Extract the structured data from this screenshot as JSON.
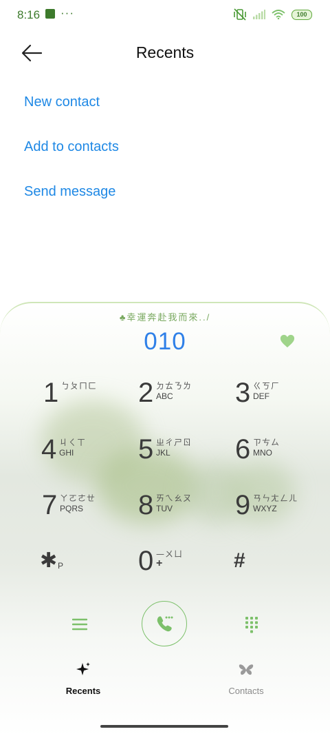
{
  "status_bar": {
    "time": "8:16",
    "dots": "···",
    "battery": "100"
  },
  "header": {
    "title": "Recents"
  },
  "options": {
    "new_contact": "New contact",
    "add_to_contacts": "Add to contacts",
    "send_message": "Send message"
  },
  "dialer": {
    "slogan": "幸運奔赴我而來../",
    "number": "010",
    "keys": [
      {
        "digit": "1",
        "zhuyin": "ㄅㄆㄇㄈ",
        "letters": ""
      },
      {
        "digit": "2",
        "zhuyin": "ㄉㄊㄋㄌ",
        "letters": "ABC"
      },
      {
        "digit": "3",
        "zhuyin": "ㄍㄎㄏ",
        "letters": "DEF"
      },
      {
        "digit": "4",
        "zhuyin": "ㄐㄑㄒ",
        "letters": "GHI"
      },
      {
        "digit": "5",
        "zhuyin": "ㄓㄔㄕㄖ",
        "letters": "JKL"
      },
      {
        "digit": "6",
        "zhuyin": "ㄗㄘㄙ",
        "letters": "MNO"
      },
      {
        "digit": "7",
        "zhuyin": "ㄚㄛㄜㄝ",
        "letters": "PQRS"
      },
      {
        "digit": "8",
        "zhuyin": "ㄞㄟㄠㄡ",
        "letters": "TUV"
      },
      {
        "digit": "9",
        "zhuyin": "ㄢㄣㄤㄥㄦ",
        "letters": "WXYZ"
      },
      {
        "digit": "✱",
        "zhuyin": "",
        "letters": "P"
      },
      {
        "digit": "0",
        "zhuyin": "—ㄨㄩ",
        "letters": "+"
      },
      {
        "digit": "#",
        "zhuyin": "",
        "letters": ""
      }
    ],
    "icons": {
      "menu": "menu-icon",
      "call": "phone-call-icon",
      "keypad": "keypad-icon"
    }
  },
  "nav": {
    "recents": "Recents",
    "contacts": "Contacts"
  },
  "colors": {
    "accent_blue": "#1e88e5",
    "green": "#7cc06a"
  }
}
